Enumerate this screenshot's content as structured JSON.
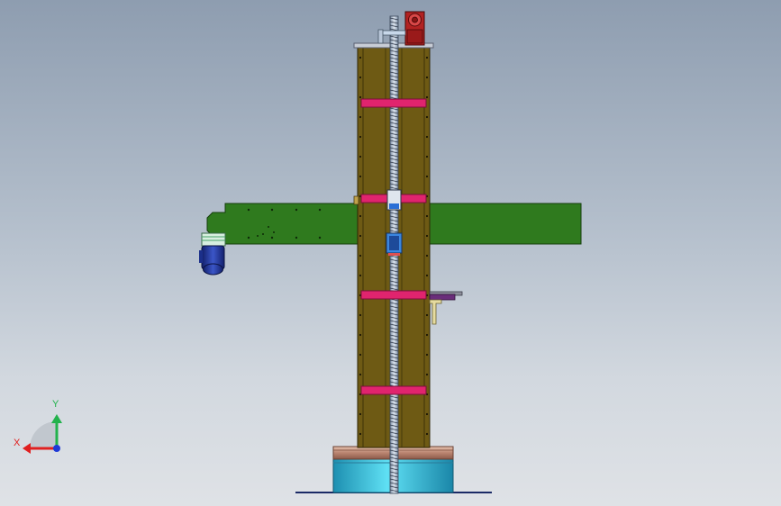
{
  "window": {
    "kind": "CAD 3D viewport",
    "background": [
      "#8e9db0",
      "#dfe2e6"
    ]
  },
  "triad": {
    "x_label": "X",
    "y_label": "Y",
    "x_color": "#e02020",
    "y_color": "#22b24c",
    "z_color": "#1f3ad6"
  },
  "model": {
    "column_color": "#6e5a14",
    "band_color": "#e0246e",
    "arm_color": "#2f7a1e",
    "motor_color": "#1e2f8c",
    "base_color": "#2fb6d6",
    "flange_color": "#c89a80",
    "gearbox_color": "#b22222",
    "bracket_color": "#6a2d7a"
  }
}
